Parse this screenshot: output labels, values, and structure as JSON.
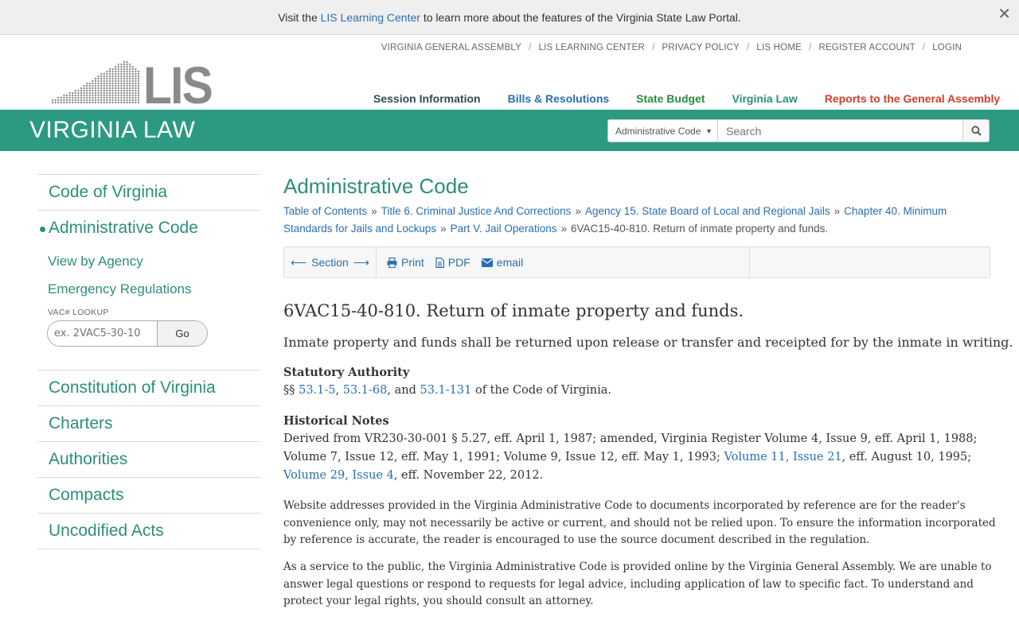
{
  "notice": {
    "prefix": "Visit the",
    "link": "LIS Learning Center",
    "suffix": "to learn more about the features of the Virginia State Law Portal."
  },
  "logo": {
    "text": "LIS"
  },
  "topnav": [
    "VIRGINIA GENERAL ASSEMBLY",
    "LIS LEARNING CENTER",
    "PRIVACY POLICY",
    "LIS HOME",
    "REGISTER ACCOUNT",
    "LOGIN"
  ],
  "mainnav": [
    {
      "label": "Session Information",
      "color": "#2f4a5a"
    },
    {
      "label": "Bills & Resolutions",
      "color": "#2a6fb0"
    },
    {
      "label": "State Budget",
      "color": "#2e8a3e"
    },
    {
      "label": "Virginia Law",
      "color": "#2c8f78"
    },
    {
      "label": "Reports to the General Assembly",
      "color": "#d0402a"
    }
  ],
  "band": {
    "title": "VIRGINIA LAW",
    "search_scope": "Administrative Code",
    "search_placeholder": "Search"
  },
  "sidebar": {
    "top_items": [
      "Code of Virginia",
      "Administrative Code"
    ],
    "sub_items": [
      "View by Agency",
      "Emergency Regulations"
    ],
    "vac_label": "VAC# LOOKUP",
    "vac_placeholder": "ex. 2VAC5-30-10",
    "go": "Go",
    "bottom_items": [
      "Constitution of Virginia",
      "Charters",
      "Authorities",
      "Compacts",
      "Uncodified Acts"
    ]
  },
  "main": {
    "heading": "Administrative Code",
    "breadcrumbs": [
      "Table of Contents",
      "Title 6. Criminal Justice And Corrections",
      "Agency 15. State Board of Local and Regional Jails",
      "Chapter 40. Minimum Standards for Jails and Lockups",
      "Part V. Jail Operations"
    ],
    "current": "6VAC15-40-810. Return of inmate property and funds.",
    "toolbar": {
      "section": "Section",
      "print": "Print",
      "pdf": "PDF",
      "email": "email"
    },
    "section_title": "6VAC15-40-810. Return of inmate property and funds.",
    "summary": "Inmate property and funds shall be returned upon release or transfer and receipted for by the inmate in writing.",
    "statutory": {
      "heading": "Statutory Authority",
      "prefix": "§§",
      "links": [
        "53.1-5",
        "53.1-68",
        "53.1-131"
      ],
      "comma": ",",
      "and": ", and",
      "suffix": "of the Code of Virginia."
    },
    "historical": {
      "heading": "Historical Notes",
      "text1": "Derived from VR230-30-001 § 5.27, eff. April 1, 1987; amended, Virginia Register Volume 4, Issue 9, eff. April 1, 1988; Volume 7, Issue 12, eff. May 1, 1991; Volume 9, Issue 12, eff. May 1, 1993;",
      "link1": "Volume 11, Issue 21",
      "text2": ", eff. August 10, 1995;",
      "link2": "Volume 29, Issue 4",
      "text3": ", eff. November 22, 2012."
    },
    "note1": "Website addresses provided in the Virginia Administrative Code to documents incorporated by reference are for the reader's convenience only, may not necessarily be active or current, and should not be relied upon. To ensure the information incorporated by reference is accurate, the reader is encouraged to use the source document described in the regulation.",
    "note2": "As a service to the public, the Virginia Administrative Code is provided online by the Virginia General Assembly. We are unable to answer legal questions or respond to requests for legal advice, including application of law to specific fact. To understand and protect your legal rights, you should consult an attorney."
  }
}
